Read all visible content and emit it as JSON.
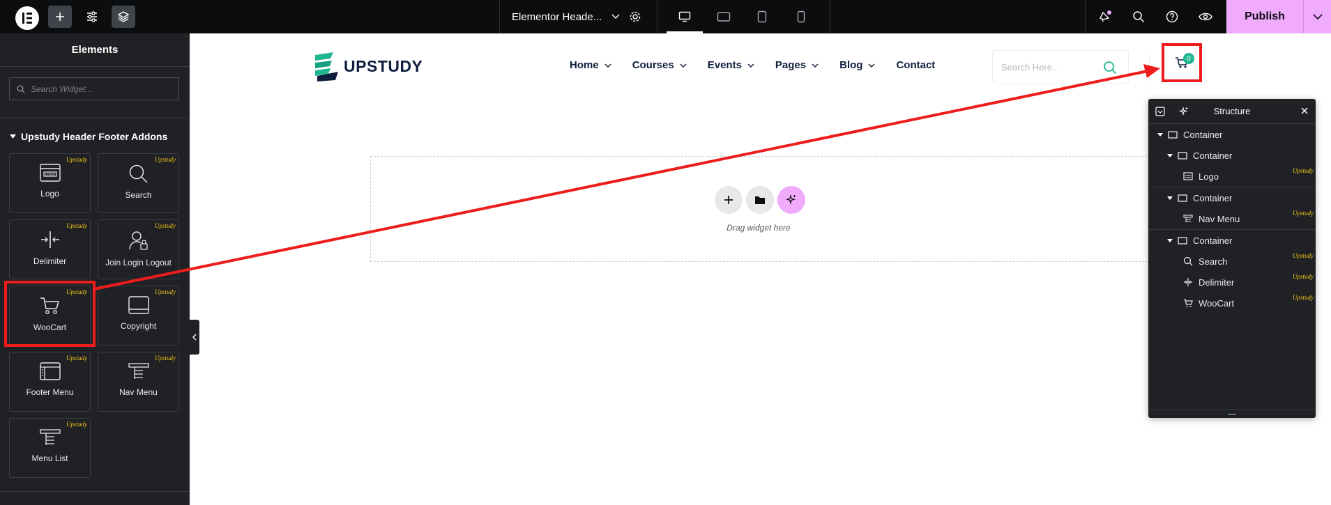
{
  "topbar": {
    "document_title": "Elementor Heade...",
    "publish_label": "Publish"
  },
  "panel": {
    "title": "Elements",
    "search_placeholder": "Search Widget...",
    "category_title": "Upstudy Header Footer Addons",
    "badge_text": "Upstudy",
    "widgets": [
      {
        "label": "Logo",
        "icon": "logo-widget-icon"
      },
      {
        "label": "Search",
        "icon": "search-widget-icon"
      },
      {
        "label": "Delimiter",
        "icon": "delimiter-widget-icon"
      },
      {
        "label": "Join Login Logout",
        "icon": "user-lock-widget-icon"
      },
      {
        "label": "WooCart",
        "icon": "cart-widget-icon"
      },
      {
        "label": "Copyright",
        "icon": "copyright-widget-icon"
      },
      {
        "label": "Footer Menu",
        "icon": "footer-menu-widget-icon"
      },
      {
        "label": "Nav Menu",
        "icon": "nav-menu-widget-icon"
      },
      {
        "label": "Menu List",
        "icon": "menu-list-widget-icon"
      }
    ]
  },
  "site": {
    "logo_text": "UPSTUDY",
    "nav": [
      "Home",
      "Courses",
      "Events",
      "Pages",
      "Blog",
      "Contact"
    ],
    "search_placeholder": "Search Here..",
    "cart_count": "0"
  },
  "dropzone": {
    "text": "Drag widget here"
  },
  "structure": {
    "title": "Structure",
    "badge_text": "Upstudy",
    "rows": [
      {
        "label": "Container",
        "level": 0,
        "type": "container"
      },
      {
        "label": "Container",
        "level": 1,
        "type": "container"
      },
      {
        "label": "Logo",
        "level": 2,
        "type": "widget",
        "badge": true
      },
      {
        "label": "Container",
        "level": 1,
        "type": "container"
      },
      {
        "label": "Nav Menu",
        "level": 2,
        "type": "widget",
        "badge": true
      },
      {
        "label": "Container",
        "level": 1,
        "type": "container"
      },
      {
        "label": "Search",
        "level": 2,
        "type": "widget",
        "badge": true
      },
      {
        "label": "Delimiter",
        "level": 2,
        "type": "widget",
        "badge": true
      },
      {
        "label": "WooCart",
        "level": 2,
        "type": "widget",
        "badge": true
      }
    ]
  },
  "colors": {
    "highlight": "#ee1c1c",
    "publish": "#f0abfc",
    "panel_bg": "#1f2124",
    "badge": "#f0c419",
    "brand_green": "#1eb68f",
    "navy": "#0f1e3d"
  }
}
